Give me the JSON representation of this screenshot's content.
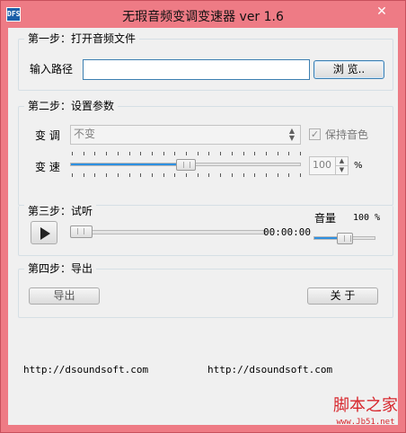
{
  "window": {
    "title": "无瑕音频变调变速器 ver 1.6",
    "icon_text": "DFS",
    "close_glyph": "✕"
  },
  "step1": {
    "title": "第一步：打开音频文件",
    "path_label": "输入路径",
    "path_value": "",
    "browse_label": "浏 览.."
  },
  "step2": {
    "title": "第二步：设置参数",
    "pitch_label": "变 调",
    "pitch_value": "不变",
    "keep_tone_label": "保持音色",
    "keep_tone_checked": true,
    "speed_label": "变 速",
    "speed_value": "100",
    "speed_percent": 50,
    "speed_unit": "%"
  },
  "step3": {
    "title": "第三步：试听",
    "time": "00:00:00",
    "volume_label": "音量",
    "volume_value": "100 %",
    "progress_percent": 0,
    "volume_percent": 50
  },
  "step4": {
    "title": "第四步：导出",
    "export_label": "导出",
    "close_label": "关 于"
  },
  "footer": {
    "url_left": "http://dsoundsoft.com",
    "url_right": "http://dsoundsoft.com"
  },
  "watermark": {
    "main": "脚本之家",
    "sub": "www.Jb51.net"
  },
  "colors": {
    "titlebar": "#ee7b85",
    "accent": "#2d8fe0"
  }
}
